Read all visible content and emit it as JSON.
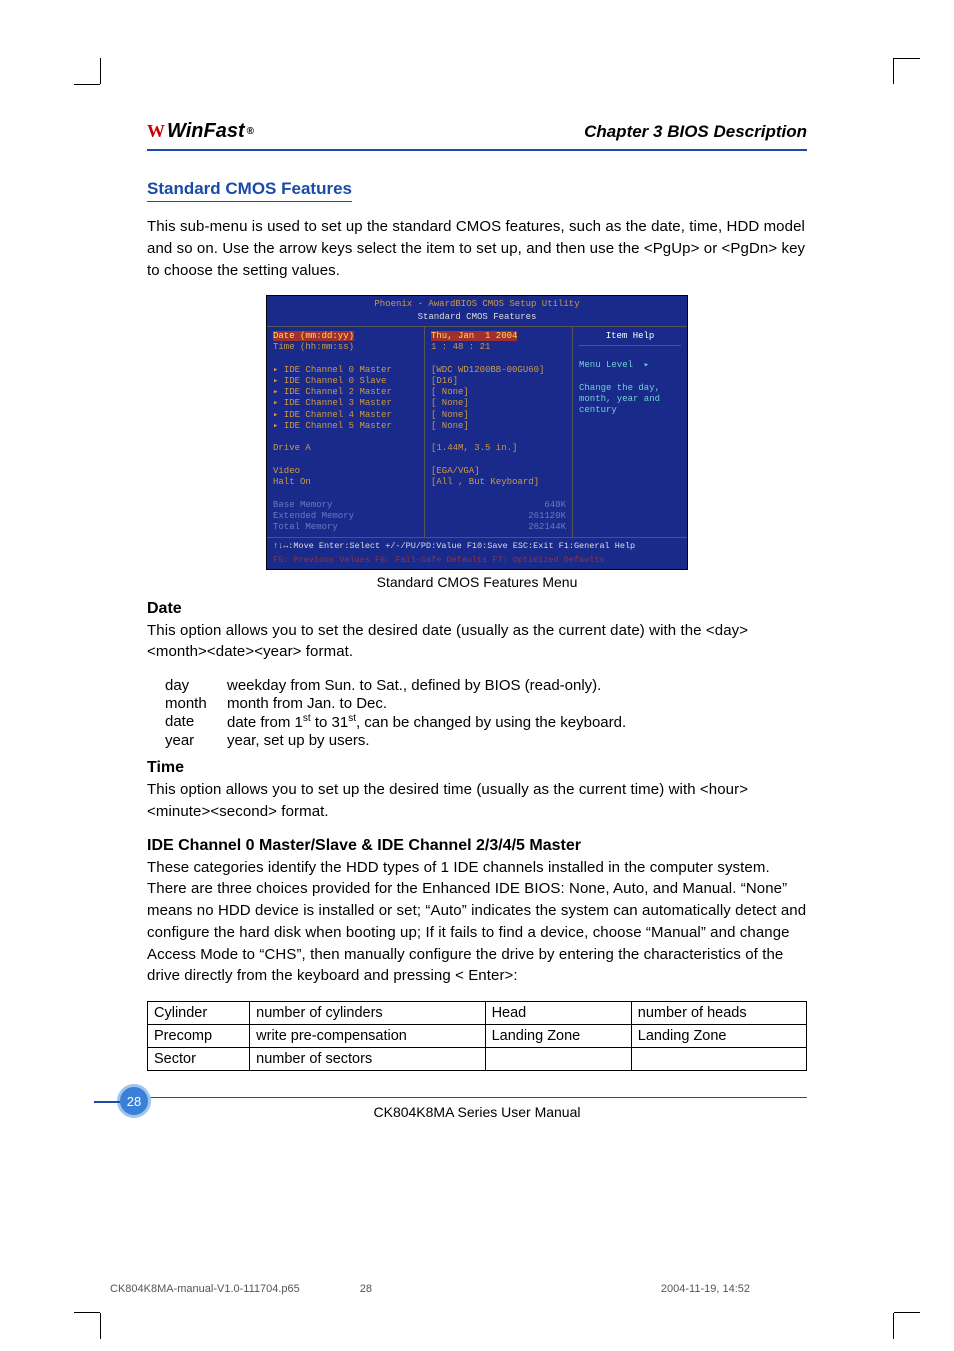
{
  "header": {
    "logo_text": "WinFast",
    "logo_mark": "W",
    "logo_reg": "®",
    "chapter": "Chapter 3   BIOS Description"
  },
  "section1": {
    "title": "Standard CMOS Features",
    "intro": "This sub-menu is used to set up the standard CMOS features, such as the date, time, HDD model and so on. Use the arrow keys select the item to set up, and then use the <PgUp> or <PgDn> key to choose the setting values."
  },
  "bios": {
    "title1": "Phoenix - AwardBIOS CMOS Setup Utility",
    "title2": "Standard CMOS Features",
    "date_label": "Date (mm:dd:yy)",
    "date_value": "Thu, Jan  1 2004",
    "time_label": "Time (hh:mm:ss)",
    "time_value": "1 : 48 : 21",
    "ide0m": "IDE Channel 0 Master",
    "ide0m_v": "[WDC WD1200BB-00GU60]",
    "ide0s": "IDE Channel 0 Slave",
    "ide0s_v": "[D16]",
    "ide2m": "IDE Channel 2 Master",
    "ide2m_v": "[ None]",
    "ide3m": "IDE Channel 3 Master",
    "ide3m_v": "[ None]",
    "ide4m": "IDE Channel 4 Master",
    "ide4m_v": "[ None]",
    "ide5m": "IDE Channel 5 Master",
    "ide5m_v": "[ None]",
    "driveA": "Drive A",
    "driveA_v": "[1.44M, 3.5 in.]",
    "video": "Video",
    "video_v": "[EGA/VGA]",
    "halt": "Halt On",
    "halt_v": "[All , But Keyboard]",
    "base": "Base Memory",
    "base_v": "640K",
    "ext": "Extended Memory",
    "ext_v": "261120K",
    "tot": "Total Memory",
    "tot_v": "262144K",
    "help_title": "Item Help",
    "menu_level": "Menu Level  ▸",
    "help_text": "Change the day, month, year and century",
    "bottom1": "↑↓↔:Move  Enter:Select  +/-/PU/PD:Value  F10:Save  ESC:Exit  F1:General Help",
    "bottom2": "F5: Previous Values   F6: Fail-Safe Defaults   F7: Optimized Defaults"
  },
  "caption": "Standard CMOS Features Menu",
  "date": {
    "heading": "Date",
    "body": "This option allows you to set the desired date (usually as the current date) with the <day><month><date><year> format.",
    "rows": {
      "day_k": "day",
      "day_v": "weekday from Sun. to Sat., defined by BIOS (read-only).",
      "month_k": "month",
      "month_v": "month from Jan. to Dec.",
      "date_k": "date",
      "date_v_pre": "date from 1",
      "date_v_mid": " to 31",
      "date_v_post": ", can be changed by using the keyboard.",
      "year_k": "year",
      "year_v": "year, set up by users."
    }
  },
  "time": {
    "heading": "Time",
    "body": "This option allows you to set up the desired time (usually as the current time) with <hour><minute><second> format."
  },
  "ide": {
    "heading": "IDE Channel 0 Master/Slave & IDE Channel 2/3/4/5 Master",
    "body": "These categories identify the HDD types of 1 IDE channels installed in the computer system. There are three choices provided for the Enhanced IDE BIOS: None, Auto, and Manual. “None” means no HDD device is installed or set; “Auto” indicates the system can automatically detect and configure the hard disk when booting up; If it fails to find a device, choose “Manual” and change Access Mode to “CHS”, then manually configure the drive by entering the characteristics of the drive directly from the keyboard and pressing < Enter>:"
  },
  "table": {
    "r1c1": "Cylinder",
    "r1c2": "number of cylinders",
    "r1c3": "Head",
    "r1c4": "number of heads",
    "r2c1": "Precomp",
    "r2c2": "write pre-compensation",
    "r2c3": "Landing Zone",
    "r2c4": "Landing Zone",
    "r3c1": "Sector",
    "r3c2": "number of sectors",
    "r3c3": "",
    "r3c4": ""
  },
  "footer": {
    "manual": "CK804K8MA Series User Manual",
    "pagenum": "28"
  },
  "printfoot": {
    "file": "CK804K8MA-manual-V1.0-111704.p65",
    "pg": "28",
    "ts": "2004-11-19, 14:52"
  }
}
